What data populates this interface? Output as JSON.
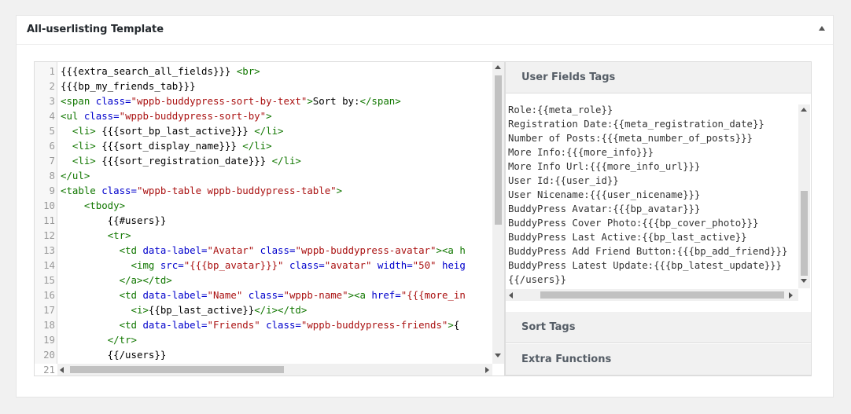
{
  "metabox": {
    "title": "All-userlisting Template",
    "toggle_icon": "triangle-up-icon"
  },
  "editor": {
    "lines": [
      {
        "n": "1",
        "parts": [
          [
            "t",
            "{{{extra_search_all_fields}}} "
          ],
          [
            "tag",
            "<br>"
          ]
        ]
      },
      {
        "n": "2",
        "parts": [
          [
            "t",
            "{{{bp_my_friends_tab}}}"
          ]
        ]
      },
      {
        "n": "3",
        "parts": [
          [
            "tag",
            "<span "
          ],
          [
            "attr",
            "class="
          ],
          [
            "str",
            "\"wppb-buddypress-sort-by-text\""
          ],
          [
            "tag",
            ">"
          ],
          [
            "t",
            "Sort by:"
          ],
          [
            "tag",
            "</span>"
          ]
        ]
      },
      {
        "n": "4",
        "parts": [
          [
            "tag",
            "<ul "
          ],
          [
            "attr",
            "class="
          ],
          [
            "str",
            "\"wppb-buddypress-sort-by\""
          ],
          [
            "tag",
            ">"
          ]
        ]
      },
      {
        "n": "5",
        "parts": [
          [
            "t",
            "  "
          ],
          [
            "tag",
            "<li>"
          ],
          [
            "t",
            " {{{sort_bp_last_active}}} "
          ],
          [
            "tag",
            "</li>"
          ]
        ]
      },
      {
        "n": "6",
        "parts": [
          [
            "t",
            "  "
          ],
          [
            "tag",
            "<li>"
          ],
          [
            "t",
            " {{{sort_display_name}}} "
          ],
          [
            "tag",
            "</li>"
          ]
        ]
      },
      {
        "n": "7",
        "parts": [
          [
            "t",
            "  "
          ],
          [
            "tag",
            "<li>"
          ],
          [
            "t",
            " {{{sort_registration_date}}} "
          ],
          [
            "tag",
            "</li>"
          ]
        ]
      },
      {
        "n": "8",
        "parts": [
          [
            "tag",
            "</ul>"
          ]
        ]
      },
      {
        "n": "9",
        "parts": [
          [
            "tag",
            "<table "
          ],
          [
            "attr",
            "class="
          ],
          [
            "str",
            "\"wppb-table wppb-buddypress-table\""
          ],
          [
            "tag",
            ">"
          ]
        ]
      },
      {
        "n": "10",
        "parts": [
          [
            "t",
            "    "
          ],
          [
            "tag",
            "<tbody>"
          ]
        ]
      },
      {
        "n": "11",
        "parts": [
          [
            "t",
            "        {{#users}}"
          ]
        ]
      },
      {
        "n": "12",
        "parts": [
          [
            "t",
            "        "
          ],
          [
            "tag",
            "<tr>"
          ]
        ]
      },
      {
        "n": "13",
        "parts": [
          [
            "t",
            "          "
          ],
          [
            "tag",
            "<td "
          ],
          [
            "attr",
            "data-label="
          ],
          [
            "str",
            "\"Avatar\""
          ],
          [
            "t",
            " "
          ],
          [
            "attr",
            "class="
          ],
          [
            "str",
            "\"wppb-buddypress-avatar\""
          ],
          [
            "tag",
            "><a h"
          ]
        ]
      },
      {
        "n": "14",
        "parts": [
          [
            "t",
            "            "
          ],
          [
            "tag",
            "<img "
          ],
          [
            "attr",
            "src="
          ],
          [
            "str",
            "\"{{{bp_avatar}}}\""
          ],
          [
            "t",
            " "
          ],
          [
            "attr",
            "class="
          ],
          [
            "str",
            "\"avatar\""
          ],
          [
            "t",
            " "
          ],
          [
            "attr",
            "width="
          ],
          [
            "str",
            "\"50\""
          ],
          [
            "t",
            " "
          ],
          [
            "attr",
            "heig"
          ]
        ]
      },
      {
        "n": "15",
        "parts": [
          [
            "t",
            "          "
          ],
          [
            "tag",
            "</a></td>"
          ]
        ]
      },
      {
        "n": "16",
        "parts": [
          [
            "t",
            "          "
          ],
          [
            "tag",
            "<td "
          ],
          [
            "attr",
            "data-label="
          ],
          [
            "str",
            "\"Name\""
          ],
          [
            "t",
            " "
          ],
          [
            "attr",
            "class="
          ],
          [
            "str",
            "\"wppb-name\""
          ],
          [
            "tag",
            "><a "
          ],
          [
            "attr",
            "href="
          ],
          [
            "str",
            "\"{{{more_in"
          ]
        ]
      },
      {
        "n": "17",
        "parts": [
          [
            "t",
            "            "
          ],
          [
            "tag",
            "<i>"
          ],
          [
            "t",
            "{{bp_last_active}}"
          ],
          [
            "tag",
            "</i></td>"
          ]
        ]
      },
      {
        "n": "18",
        "parts": [
          [
            "t",
            "          "
          ],
          [
            "tag",
            "<td "
          ],
          [
            "attr",
            "data-label="
          ],
          [
            "str",
            "\"Friends\""
          ],
          [
            "t",
            " "
          ],
          [
            "attr",
            "class="
          ],
          [
            "str",
            "\"wppb-buddypress-friends\""
          ],
          [
            "tag",
            ">"
          ],
          [
            "t",
            "{"
          ]
        ]
      },
      {
        "n": "19",
        "parts": [
          [
            "t",
            "        "
          ],
          [
            "tag",
            "</tr>"
          ]
        ]
      },
      {
        "n": "20",
        "parts": [
          [
            "t",
            "        {{/users}}"
          ]
        ]
      },
      {
        "n": "21",
        "parts": [
          [
            "t",
            ""
          ]
        ]
      }
    ]
  },
  "accordion": {
    "user_fields_title": "User Fields Tags",
    "sort_tags_title": "Sort Tags",
    "extra_functions_title": "Extra Functions",
    "tags": [
      "Role:{{meta_role}}",
      "Registration Date:{{meta_registration_date}}",
      "Number of Posts:{{{meta_number_of_posts}}}",
      "More Info:{{{more_info}}}",
      "More Info Url:{{{more_info_url}}}",
      "User Id:{{user_id}}",
      "User Nicename:{{{user_nicename}}}",
      "BuddyPress Avatar:{{{bp_avatar}}}",
      "BuddyPress Cover Photo:{{{bp_cover_photo}}}",
      "BuddyPress Last Active:{{bp_last_active}}",
      "BuddyPress Add Friend Button:{{{bp_add_friend}}}",
      "BuddyPress Latest Update:{{{bp_latest_update}}}",
      "{{/users}}"
    ]
  }
}
